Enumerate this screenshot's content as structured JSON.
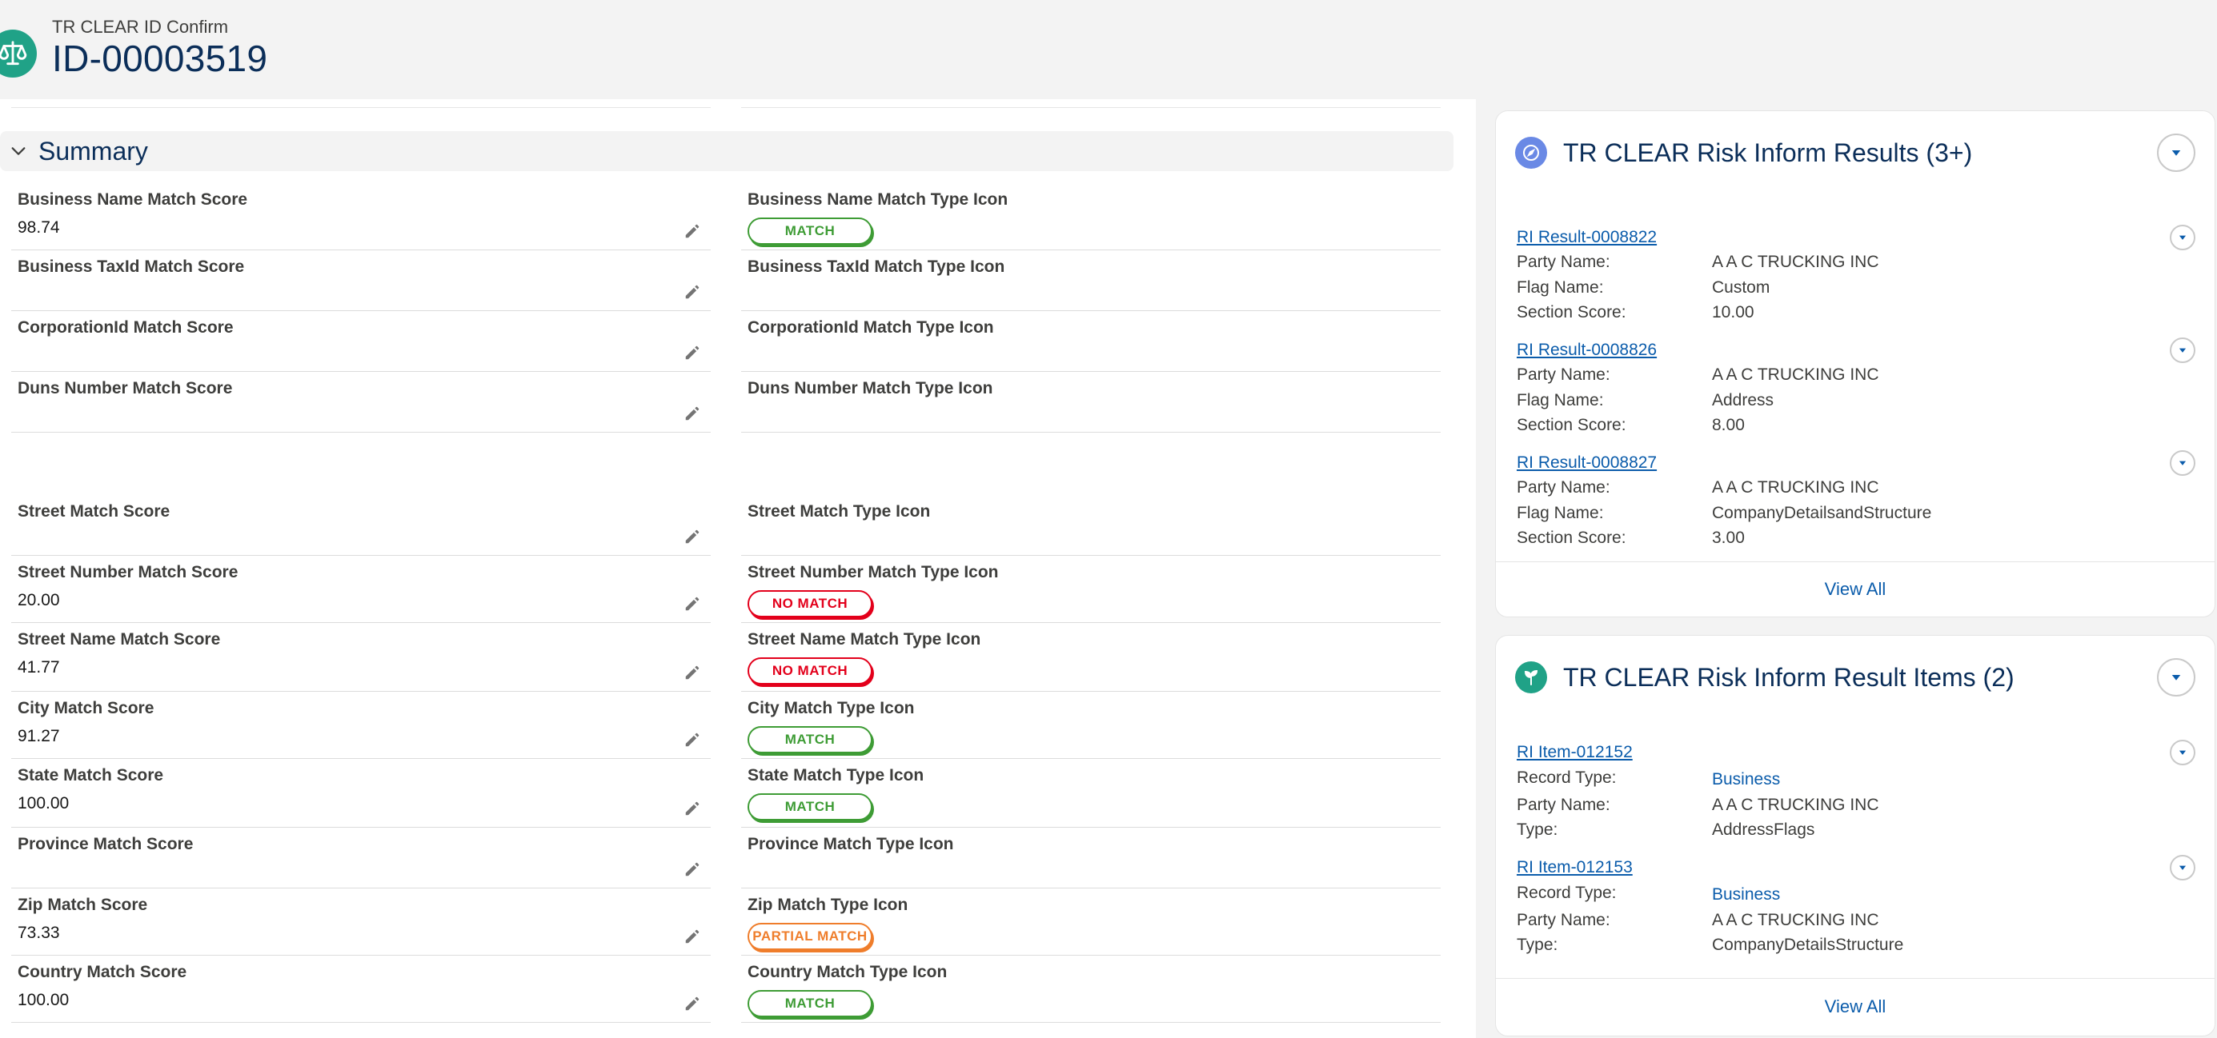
{
  "header": {
    "object_label": "TR CLEAR ID Confirm",
    "record_title": "ID-00003519"
  },
  "summary": {
    "title": "Summary",
    "left_fields": [
      {
        "label": "Business Name Match Score",
        "value": "98.74"
      },
      {
        "label": "Business TaxId Match Score",
        "value": ""
      },
      {
        "label": "CorporationId Match Score",
        "value": ""
      },
      {
        "label": "Duns Number Match Score",
        "value": ""
      },
      {
        "label": "Street Match Score",
        "value": ""
      },
      {
        "label": "Street Number Match Score",
        "value": "20.00"
      },
      {
        "label": "Street Name Match Score",
        "value": "41.77"
      },
      {
        "label": "City Match Score",
        "value": "91.27"
      },
      {
        "label": "State Match Score",
        "value": "100.00"
      },
      {
        "label": "Province Match Score",
        "value": ""
      },
      {
        "label": "Zip Match Score",
        "value": "73.33"
      },
      {
        "label": "Country Match Score",
        "value": "100.00"
      }
    ],
    "right_fields": [
      {
        "label": "Business Name Match Type Icon",
        "badge": "MATCH"
      },
      {
        "label": "Business TaxId Match Type Icon",
        "badge": ""
      },
      {
        "label": "CorporationId Match Type Icon",
        "badge": ""
      },
      {
        "label": "Duns Number Match Type Icon",
        "badge": ""
      },
      {
        "label": "Street Match Type Icon",
        "badge": ""
      },
      {
        "label": "Street Number Match Type Icon",
        "badge": "NO MATCH"
      },
      {
        "label": "Street Name Match Type Icon",
        "badge": "NO MATCH"
      },
      {
        "label": "City Match Type Icon",
        "badge": "MATCH"
      },
      {
        "label": "State Match Type Icon",
        "badge": "MATCH"
      },
      {
        "label": "Province Match Type Icon",
        "badge": ""
      },
      {
        "label": "Zip Match Type Icon",
        "badge": "PARTIAL MATCH"
      },
      {
        "label": "Country Match Type Icon",
        "badge": "MATCH"
      }
    ]
  },
  "results_card": {
    "title": "TR CLEAR Risk Inform Results (3+)",
    "icon": "compass-icon",
    "icon_color": "#6a89e5",
    "items": [
      {
        "name": "RI Result-0008822",
        "party_label": "Party Name:",
        "party": "A A C TRUCKING INC",
        "flag_label": "Flag Name:",
        "flag": "Custom",
        "score_label": "Section Score:",
        "score": "10.00"
      },
      {
        "name": "RI Result-0008826",
        "party_label": "Party Name:",
        "party": "A A C TRUCKING INC",
        "flag_label": "Flag Name:",
        "flag": "Address",
        "score_label": "Section Score:",
        "score": "8.00"
      },
      {
        "name": "RI Result-0008827",
        "party_label": "Party Name:",
        "party": "A A C TRUCKING INC",
        "flag_label": "Flag Name:",
        "flag": "CompanyDetailsandStructure",
        "score_label": "Section Score:",
        "score": "3.00"
      }
    ],
    "view_all": "View All"
  },
  "items_card": {
    "title": "TR CLEAR Risk Inform Result Items (2)",
    "icon": "plant-icon",
    "icon_color": "#20a287",
    "items": [
      {
        "name": "RI Item-012152",
        "record_type_label": "Record Type:",
        "record_type": "Business",
        "party_label": "Party Name:",
        "party": "A A C TRUCKING INC",
        "type_label": "Type:",
        "type": "AddressFlags"
      },
      {
        "name": "RI Item-012153",
        "record_type_label": "Record Type:",
        "record_type": "Business",
        "party_label": "Party Name:",
        "party": "A A C TRUCKING INC",
        "type_label": "Type:",
        "type": "CompanyDetailsStructure"
      }
    ],
    "view_all": "View All"
  },
  "colors": {
    "brand": "#20a287",
    "title_navy": "#0b2e59",
    "link": "#0b5cab",
    "match_green": "#3e9c35",
    "nomatch_red": "#e3001b",
    "partial_orange": "#ef7d2b"
  }
}
